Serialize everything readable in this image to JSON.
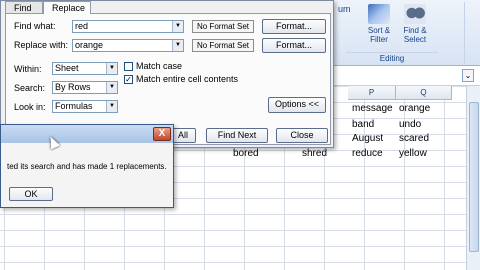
{
  "ribbon": {
    "autosum_label": "um",
    "sort_filter": {
      "line1": "Sort &",
      "line2": "Filter"
    },
    "find_select": {
      "line1": "Find &",
      "line2": "Select"
    },
    "group_label": "Editing"
  },
  "sheet": {
    "col_headers": [
      "P",
      "Q"
    ],
    "rows": [
      [
        "message",
        "orange"
      ],
      [
        "band",
        "undo"
      ],
      [
        "August",
        "scared"
      ],
      [
        "reduce",
        "yellow"
      ]
    ],
    "partial_row": [
      "bored",
      "shred"
    ]
  },
  "find_replace": {
    "tabs": [
      "Find",
      "Replace"
    ],
    "active_tab": "Replace",
    "find_what_label": "Find what:",
    "find_what_value": "red",
    "replace_with_label": "Replace with:",
    "replace_with_value": "orange",
    "no_format_label": "No Format Set",
    "format_button": "Format...",
    "within_label": "Within:",
    "within_value": "Sheet",
    "search_label": "Search:",
    "search_value": "By Rows",
    "lookin_label": "Look in:",
    "lookin_value": "Formulas",
    "match_case_label": "Match case",
    "match_case_checked": false,
    "match_entire_label": "Match entire cell contents",
    "match_entire_checked": true,
    "options_button": "Options <<",
    "replace_all_button": "All",
    "find_next_button": "Find Next",
    "close_button": "Close"
  },
  "message": {
    "text": "ted its search and has made 1 replacements.",
    "ok_button": "OK",
    "close_glyph": "X"
  }
}
